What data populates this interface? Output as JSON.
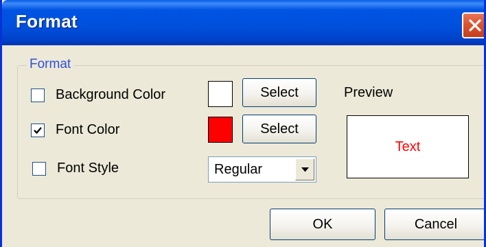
{
  "window": {
    "title": "Format",
    "close_icon": "close-icon"
  },
  "group": {
    "label": "Format"
  },
  "options": [
    {
      "label": "Background Color",
      "checked": false,
      "swatch_color": "#ffffff",
      "button_label": "Select"
    },
    {
      "label": "Font Color",
      "checked": true,
      "swatch_color": "#ff0000",
      "button_label": "Select"
    },
    {
      "label": "Font Style",
      "checked": false
    }
  ],
  "font_style": {
    "selected": "Regular"
  },
  "preview": {
    "label": "Preview",
    "sample_text": "Text",
    "text_color": "#ff0000"
  },
  "footer": {
    "ok_label": "OK",
    "cancel_label": "Cancel"
  }
}
